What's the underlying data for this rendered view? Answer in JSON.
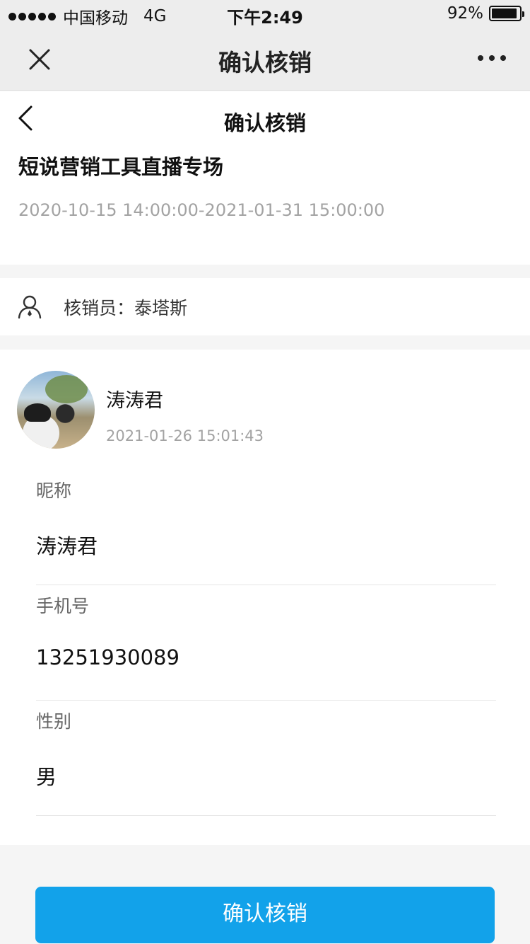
{
  "status_bar": {
    "carrier": "中国移动",
    "network": "4G",
    "time": "下午2:49",
    "battery_percent": "92%",
    "battery_level": 0.92
  },
  "wechat_nav": {
    "title": "确认核销",
    "close_icon": "close-icon",
    "more_icon": "more-dots-icon"
  },
  "page": {
    "title": "确认核销",
    "back_icon": "chevron-left-icon"
  },
  "event": {
    "name": "短说营销工具直播专场",
    "time_range": "2020-10-15 14:00:00-2021-01-31 15:00:00"
  },
  "verifier": {
    "icon": "user-icon",
    "label": "核销员：泰塔斯"
  },
  "customer": {
    "name": "涛涛君",
    "time": "2021-01-26 15:01:43",
    "fields": [
      {
        "label": "昵称",
        "value": "涛涛君"
      },
      {
        "label": "手机号",
        "value": "13251930089"
      },
      {
        "label": "性别",
        "value": "男"
      }
    ]
  },
  "confirm_button": {
    "label": "确认核销"
  },
  "colors": {
    "accent": "#12a2ea",
    "nav_background": "#ededed",
    "muted_text": "#a3a3a3"
  }
}
